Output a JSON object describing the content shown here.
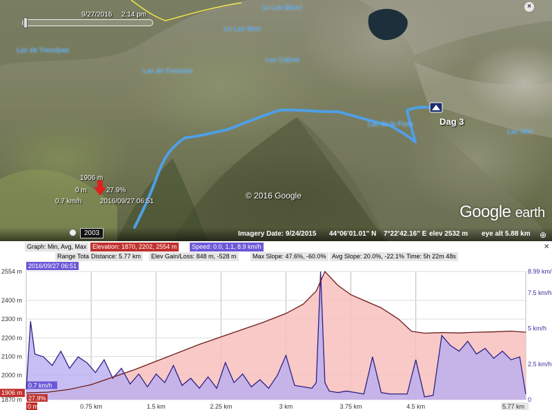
{
  "map": {
    "timestamp_date": "9/27/2016",
    "timestamp_time": "2:14 pm",
    "labels": [
      {
        "name": "le-lac-blanc",
        "text": "Le Lac Blanc"
      },
      {
        "name": "le-lac-mort",
        "text": "Le Lac Mort"
      },
      {
        "name": "lac-de-trecolpas",
        "text": "Lac de Trecolpas"
      },
      {
        "name": "lac-de-fenestre",
        "text": "Lac de Fenestre"
      },
      {
        "name": "lac-cabret",
        "text": "Lac Cabret"
      },
      {
        "name": "lac-de-la-fous",
        "text": "Lac de la Fous"
      },
      {
        "name": "lac-nire",
        "text": "Lac Niré"
      }
    ],
    "placemark_label": "Dag 3",
    "copyright": "© 2016 Google",
    "logo_google": "Google",
    "logo_earth": "earth",
    "year": "2003",
    "marker": {
      "elevation": "1906 m",
      "distance": "0 m",
      "speed": "0.7 km/h",
      "slope": "27.9%",
      "datetime": "2016/09/27 06:51"
    },
    "status": {
      "imagery_date": "Imagery Date: 9/24/2015",
      "lat": "44°06'01.01\" N",
      "lon": "7°22'42.16\" E",
      "elev": "elev   2532 m",
      "eye_alt": "eye alt    5.88 km"
    },
    "colors": {
      "track": "#4f9fe6",
      "label": "#2d8fe6",
      "marker_arrow": "#e02020",
      "border": "#f2e64a"
    }
  },
  "profile": {
    "graph_label": "Graph: Min, Avg, Max",
    "elevation_stats": "Elevation: 1870, 2202, 2554 m",
    "speed_stats": "Speed: 0.0, 1.1, 8.9 km/h",
    "range_totals_label": "Range Totals:",
    "distance": "Distance: 5.77 km",
    "elev_gain_loss": "Elev Gain/Loss: 848 m, -528 m",
    "max_slope": "Max Slope: 47.6%, -60.0%",
    "avg_slope": "Avg Slope: 20.0%, -22.1%",
    "time": "Time: 5h 22m 48s",
    "marker_time": "2016/09/27 06:51",
    "close": "✕",
    "cursor_elev": "1906 m",
    "cursor_speed": "0.7 km/h",
    "cursor_slope": "27.9%",
    "cursor_dist": "0 m",
    "colors": {
      "elevation": "#c0312e",
      "elevation_fill": "#f7c0bd",
      "speed": "#2c1f86",
      "speed_fill": "#b9aef0"
    }
  },
  "chart_data": {
    "type": "area",
    "x_unit": "km",
    "xlim": [
      0,
      5.77
    ],
    "x_ticks": [
      "0 m",
      "0.75 km",
      "1.5 km",
      "2.25 km",
      "3 km",
      "3.75 km",
      "4.5 km",
      "5.77 km"
    ],
    "y_left_ticks": [
      "2554 m",
      "2400 m",
      "2300 m",
      "2200 m",
      "2100 m",
      "2000 m",
      "1906 m",
      "1870 m"
    ],
    "y_right_ticks": [
      "8.99 km/h",
      "7.5 km/h",
      "5 km/h",
      "2.5 km/h",
      "0"
    ],
    "ylim_left": [
      1870,
      2554
    ],
    "ylim_right": [
      0,
      8.99
    ],
    "series": [
      {
        "name": "Elevation",
        "unit": "m",
        "x": [
          0,
          0.25,
          0.5,
          0.75,
          1.0,
          1.25,
          1.5,
          1.75,
          2.0,
          2.25,
          2.5,
          2.75,
          3.0,
          3.2,
          3.35,
          3.45,
          3.6,
          3.75,
          3.9,
          4.1,
          4.3,
          4.45,
          4.6,
          4.8,
          5.0,
          5.2,
          5.4,
          5.6,
          5.77
        ],
        "values": [
          1906,
          1910,
          1925,
          1950,
          1990,
          2030,
          2075,
          2120,
          2165,
          2205,
          2245,
          2285,
          2330,
          2380,
          2450,
          2554,
          2480,
          2430,
          2400,
          2360,
          2300,
          2235,
          2225,
          2228,
          2226,
          2230,
          2232,
          2236,
          2230
        ]
      },
      {
        "name": "Speed",
        "unit": "km/h",
        "x": [
          0,
          0.05,
          0.1,
          0.2,
          0.3,
          0.4,
          0.5,
          0.6,
          0.7,
          0.8,
          0.9,
          1.0,
          1.1,
          1.2,
          1.3,
          1.4,
          1.5,
          1.6,
          1.7,
          1.8,
          1.9,
          2.0,
          2.1,
          2.2,
          2.3,
          2.4,
          2.5,
          2.6,
          2.7,
          2.8,
          2.9,
          3.0,
          3.1,
          3.2,
          3.3,
          3.35,
          3.4,
          3.45,
          3.5,
          3.6,
          3.7,
          3.8,
          3.9,
          4.0,
          4.1,
          4.2,
          4.3,
          4.4,
          4.5,
          4.6,
          4.7,
          4.8,
          4.9,
          5.0,
          5.1,
          5.2,
          5.3,
          5.4,
          5.5,
          5.6,
          5.7,
          5.77
        ],
        "values": [
          0.7,
          5.5,
          3.2,
          3.0,
          2.4,
          3.4,
          2.2,
          3.0,
          2.6,
          1.9,
          2.8,
          1.5,
          2.2,
          1.1,
          1.8,
          0.9,
          1.8,
          1.2,
          2.4,
          1.0,
          1.5,
          0.8,
          1.6,
          0.8,
          2.6,
          1.2,
          1.8,
          0.9,
          1.4,
          0.8,
          1.7,
          3.1,
          1.0,
          0.9,
          0.8,
          1.2,
          8.99,
          1.2,
          0.6,
          0.5,
          0.6,
          0.5,
          0.4,
          3.0,
          0.5,
          0.4,
          0.4,
          0.4,
          2.8,
          0.2,
          0.3,
          4.5,
          3.8,
          3.4,
          4.1,
          3.2,
          3.6,
          2.9,
          3.4,
          2.8,
          3.0,
          0.4
        ]
      }
    ]
  }
}
